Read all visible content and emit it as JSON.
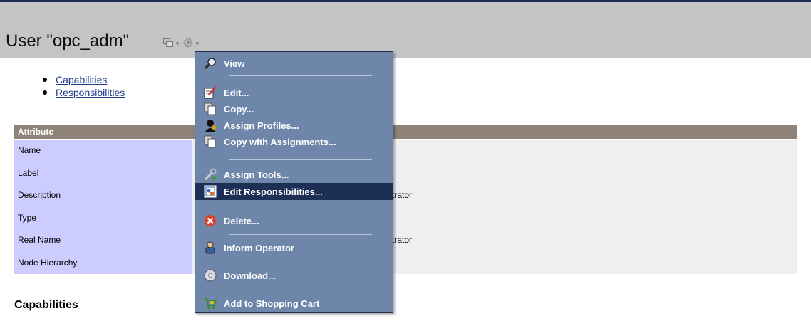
{
  "header": {
    "title": "User \"opc_adm\""
  },
  "links": [
    {
      "label": "Capabilities"
    },
    {
      "label": "Responsibilities"
    }
  ],
  "attributes_table": {
    "header": "Attribute",
    "rows": [
      {
        "name": "Name",
        "value": ""
      },
      {
        "name": "Label",
        "value": ""
      },
      {
        "name": "Description",
        "value": "trator"
      },
      {
        "name": "Type",
        "value": ""
      },
      {
        "name": "Real Name",
        "value": "trator"
      },
      {
        "name": "Node Hierarchy",
        "value": ""
      }
    ]
  },
  "section": {
    "capabilities_heading": "Capabilities"
  },
  "context_menu": {
    "items": [
      {
        "label": "View",
        "icon": "magnifier-icon"
      },
      {
        "label": "Edit...",
        "icon": "edit-icon"
      },
      {
        "label": "Copy...",
        "icon": "copy-icon"
      },
      {
        "label": "Assign Profiles...",
        "icon": "profile-icon"
      },
      {
        "label": "Copy with Assignments...",
        "icon": "copy-icon"
      },
      {
        "label": "Assign Tools...",
        "icon": "tools-icon"
      },
      {
        "label": "Edit Responsibilities...",
        "icon": "responsibilities-icon"
      },
      {
        "label": "Delete...",
        "icon": "delete-icon"
      },
      {
        "label": "Inform Operator",
        "icon": "operator-icon"
      },
      {
        "label": "Download...",
        "icon": "download-icon"
      },
      {
        "label": "Add to Shopping Cart",
        "icon": "cart-icon"
      }
    ],
    "highlighted": "Edit Responsibilities..."
  },
  "colors": {
    "menu_bg": "#6d86aa",
    "menu_highlight": "#1e2f56",
    "table_header": "#8f8378",
    "attr_name_bg": "#ccccfe",
    "title_band": "#c4c4c4"
  }
}
